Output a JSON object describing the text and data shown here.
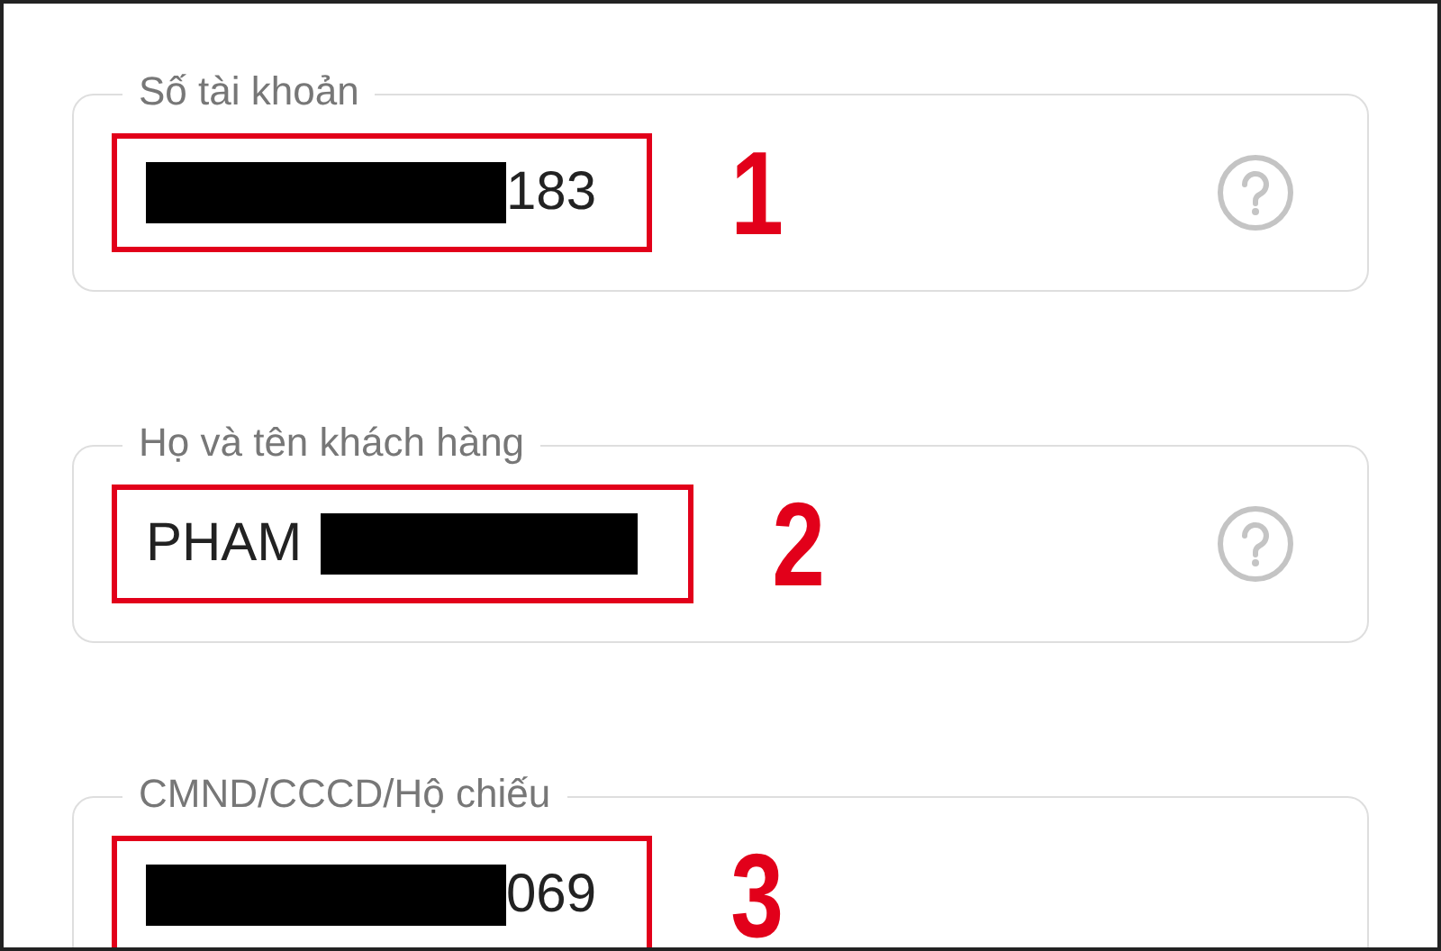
{
  "fields": [
    {
      "label": "Số tài khoản",
      "value": "183",
      "kind": "prefixhidden",
      "annotation": "1",
      "help": true
    },
    {
      "label": "Họ và tên khách hàng",
      "value": "PHAM",
      "kind": "suffixhidden",
      "annotation": "2",
      "help": true
    },
    {
      "label": "CMND/CCCD/Hộ chiếu",
      "value": "069",
      "kind": "prefixhidden",
      "annotation": "3",
      "help": false
    }
  ]
}
